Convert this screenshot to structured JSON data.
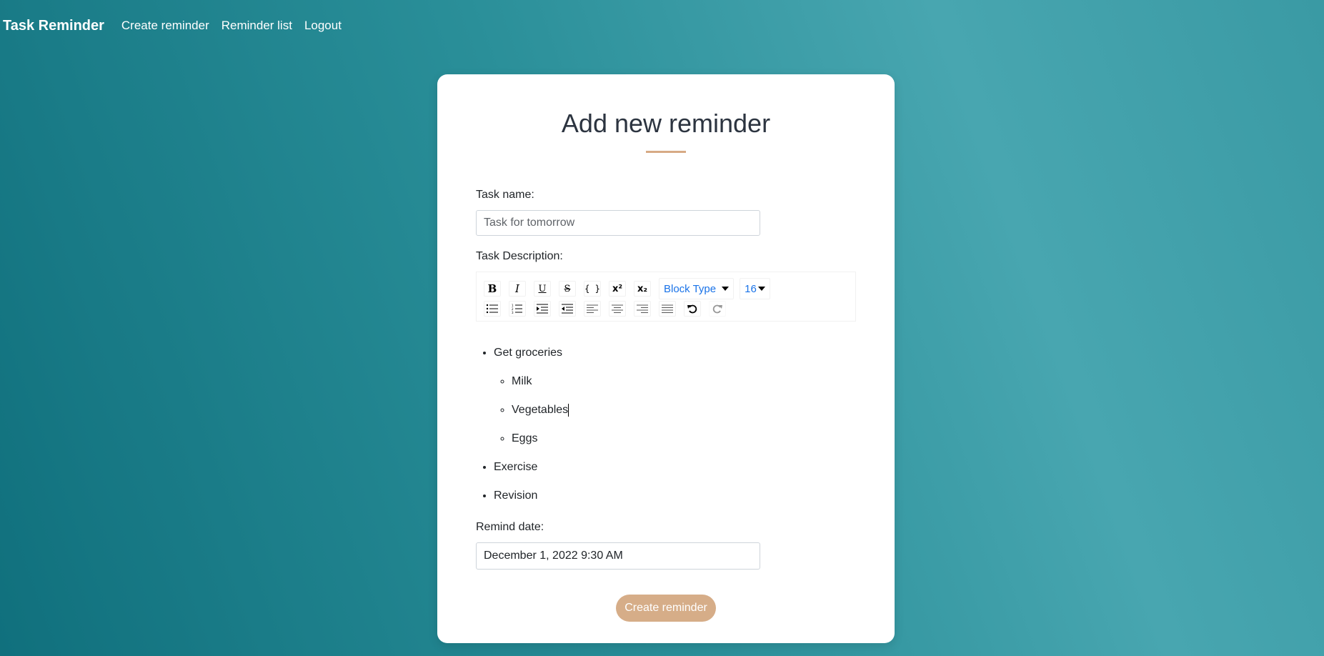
{
  "nav": {
    "brand": "Task Reminder",
    "links": [
      "Create reminder",
      "Reminder list",
      "Logout"
    ]
  },
  "card": {
    "title": "Add new reminder",
    "task_name_label": "Task name:",
    "task_name_value": "",
    "task_name_placeholder": "Task for tomorrow",
    "description_label": "Task Description:",
    "toolbar": {
      "row1_icons": [
        "bold-icon",
        "italic-icon",
        "underline-icon",
        "strikethrough-icon",
        "code-icon",
        "superscript-icon",
        "subscript-icon"
      ],
      "row1_glyphs": [
        "B",
        "I",
        "U",
        "S",
        "{ }",
        "x²",
        "x₂"
      ],
      "block_type": "Block Type",
      "font_size": "16",
      "row2_icons": [
        "unordered-list-icon",
        "ordered-list-icon",
        "indent-icon",
        "outdent-icon",
        "align-left-icon",
        "align-center-icon",
        "align-right-icon",
        "align-justify-icon",
        "undo-icon",
        "redo-icon"
      ]
    },
    "description_items": [
      {
        "text": "Get groceries",
        "children": [
          "Milk",
          "Vegetables",
          "Eggs"
        ]
      },
      {
        "text": "Exercise",
        "children": []
      },
      {
        "text": "Revision",
        "children": []
      }
    ],
    "remind_date_label": "Remind date:",
    "remind_date_value": "December 1, 2022 9:30 AM",
    "submit_label": "Create reminder"
  },
  "colors": {
    "accent": "#d6ad88",
    "background_dark": "#10707d",
    "background_light": "#48a6b0",
    "link_blue": "#1a73e8"
  }
}
